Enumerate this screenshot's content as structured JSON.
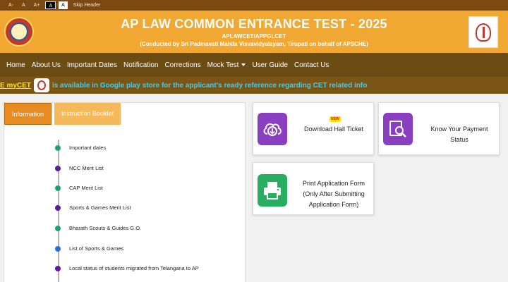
{
  "topbar": {
    "font_minus": "A-",
    "font_normal": "A",
    "font_plus": "A+",
    "theme_dark": "A",
    "theme_light": "A",
    "skip": "Skip Header"
  },
  "header": {
    "title": "AP LAW COMMON ENTRANCE TEST - 2025",
    "subtitle": "APLAWCET/APPGLCET",
    "conducted_by": "(Conducted by Sri Padmavati Mahila Visvavidyalayam, Tirupati on behalf of APSCHE)"
  },
  "nav": {
    "items": [
      "Home",
      "About Us",
      "Important Dates",
      "Notification",
      "Corrections",
      "Mock Test",
      "User Guide",
      "Contact Us"
    ]
  },
  "marquee": {
    "prefix": "E myCET",
    "text": "is available in Google play store for the applicant's ready reference regarding CET related info"
  },
  "info": {
    "tabs": [
      "Information",
      "Instruction Booklet"
    ],
    "items": [
      {
        "label": "Important dates",
        "color": "#1aa36f"
      },
      {
        "label": "NCC Merit List",
        "color": "#5b1e9f"
      },
      {
        "label": "CAP Merit List",
        "color": "#1aa36f"
      },
      {
        "label": "Sports & Games Merit List",
        "color": "#5b1e9f"
      },
      {
        "label": "Bharath Scouts & Guides G.O.",
        "color": "#1aa36f"
      },
      {
        "label": "List of Sports & Games",
        "color": "#2a6fd6"
      },
      {
        "label": "Local status of students migrated from Telangana to AP",
        "color": "#5b1e9f"
      }
    ]
  },
  "cards": {
    "hall_ticket": {
      "label": "Download Hall Ticket",
      "badge": "NEW",
      "icon": "cloud-download-icon"
    },
    "payment": {
      "label_line1": "Know Your Payment",
      "label_line2": "Status",
      "icon": "document-search-icon"
    },
    "print": {
      "label_line1": "Print Application Form",
      "label_line2": "(Only After Submitting",
      "label_line3": "Application Form)",
      "icon": "printer-icon"
    }
  },
  "colors": {
    "header_bg": "#f0a832",
    "nav_bg": "#6d4c14",
    "tab_active": "#e88b20",
    "card_purple": "#8a3fc1",
    "card_green": "#27ae60"
  }
}
